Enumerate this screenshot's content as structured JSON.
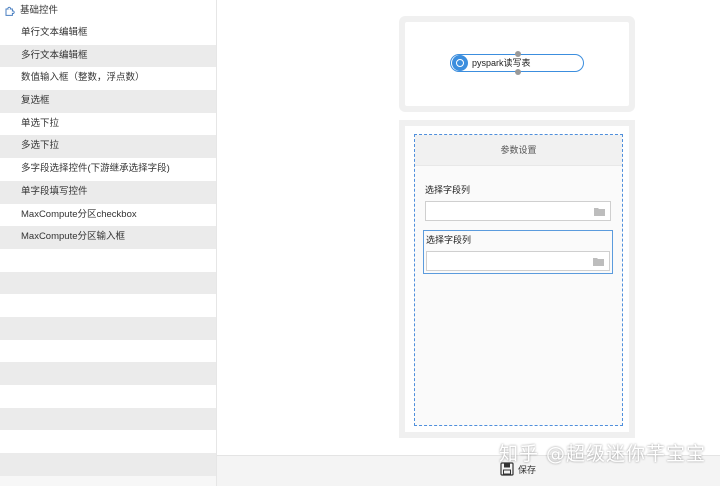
{
  "sidebar": {
    "header": "基础控件",
    "items": [
      {
        "label": "单行文本编辑框"
      },
      {
        "label": "多行文本编辑框"
      },
      {
        "label": "数值输入框（整数，浮点数）"
      },
      {
        "label": "复选框"
      },
      {
        "label": "单选下拉"
      },
      {
        "label": "多选下拉"
      },
      {
        "label": "多字段选择控件(下游继承选择字段)"
      },
      {
        "label": "单字段填写控件"
      },
      {
        "label": "MaxCompute分区checkbox"
      },
      {
        "label": "MaxCompute分区输入框"
      }
    ]
  },
  "node": {
    "label": "pyspark读写表"
  },
  "param_panel": {
    "title": "参数设置",
    "fields": [
      {
        "label": "选择字段列",
        "value": ""
      },
      {
        "label": "选择字段列",
        "value": ""
      }
    ]
  },
  "bottom_bar": {
    "save_label": "保存"
  },
  "watermark": "知乎 @超级迷你芊宝宝",
  "colors": {
    "accent": "#3c8ede",
    "dashed_border": "#4f8fdc"
  }
}
